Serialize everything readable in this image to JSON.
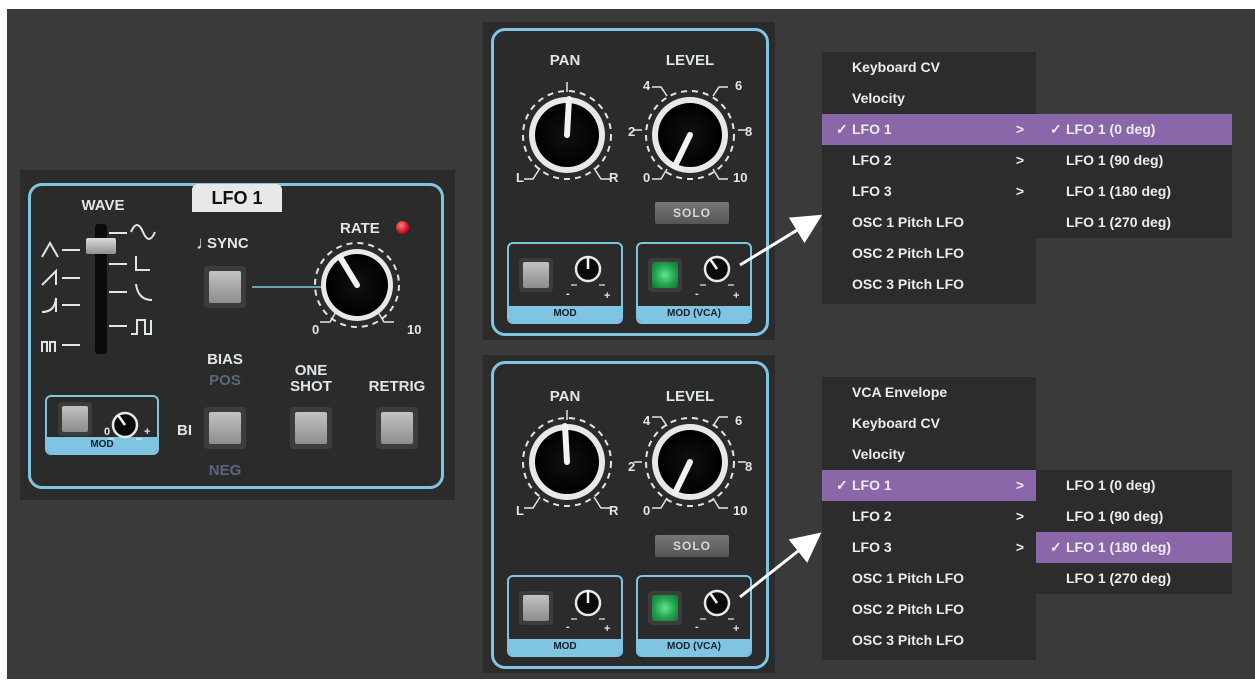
{
  "lfo": {
    "title": "LFO 1",
    "wave_label": "WAVE",
    "sync_label": "SYNC",
    "sync_note_icon": "♩",
    "rate_label": "RATE",
    "rate_min": "0",
    "rate_max": "10",
    "bias_label": "BIAS",
    "bias_pos": "POS",
    "bias_neg": "NEG",
    "bias_bi": "BI",
    "one_shot_line1": "ONE",
    "one_shot_line2": "SHOT",
    "retrig_label": "RETRIG",
    "mod_label": "MOD",
    "mod_zero": "0",
    "mod_plus": "+",
    "accent_color": "#7fc4e0",
    "led_color": "#e0202a"
  },
  "mixers": [
    {
      "pan_label": "PAN",
      "pan_left": "L",
      "pan_right": "R",
      "level_label": "LEVEL",
      "level_ticks": {
        "t0": "0",
        "t2": "2",
        "t4": "4",
        "t6": "6",
        "t8": "8",
        "t10": "10"
      },
      "solo_label": "SOLO",
      "mod_label": "MOD",
      "mod_vca_label": "MOD (VCA)",
      "minus": "-",
      "plus": "+"
    },
    {
      "pan_label": "PAN",
      "pan_left": "L",
      "pan_right": "R",
      "level_label": "LEVEL",
      "level_ticks": {
        "t0": "0",
        "t2": "2",
        "t4": "4",
        "t6": "6",
        "t8": "8",
        "t10": "10"
      },
      "solo_label": "SOLO",
      "mod_label": "MOD",
      "mod_vca_label": "MOD (VCA)",
      "minus": "-",
      "plus": "+"
    }
  ],
  "menus": [
    {
      "items": [
        {
          "label": "Keyboard CV"
        },
        {
          "label": "Velocity"
        },
        {
          "label": "LFO 1",
          "checked": "✓",
          "submenu": ">"
        },
        {
          "label": "LFO 2",
          "submenu": ">"
        },
        {
          "label": "LFO 3",
          "submenu": ">"
        },
        {
          "label": "OSC 1 Pitch LFO"
        },
        {
          "label": "OSC 2 Pitch LFO"
        },
        {
          "label": "OSC 3 Pitch LFO"
        }
      ],
      "submenu_items": [
        {
          "label": "LFO 1 (0 deg)",
          "checked": "✓"
        },
        {
          "label": "LFO 1 (90 deg)"
        },
        {
          "label": "LFO 1 (180 deg)"
        },
        {
          "label": "LFO 1 (270 deg)"
        }
      ]
    },
    {
      "items": [
        {
          "label": "VCA Envelope"
        },
        {
          "label": "Keyboard CV"
        },
        {
          "label": "Velocity"
        },
        {
          "label": "LFO 1",
          "checked": "✓",
          "submenu": ">"
        },
        {
          "label": "LFO 2",
          "submenu": ">"
        },
        {
          "label": "LFO 3",
          "submenu": ">"
        },
        {
          "label": "OSC 1 Pitch LFO"
        },
        {
          "label": "OSC 2 Pitch LFO"
        },
        {
          "label": "OSC 3 Pitch LFO"
        }
      ],
      "submenu_items": [
        {
          "label": "LFO 1 (0 deg)"
        },
        {
          "label": "LFO 1 (90 deg)"
        },
        {
          "label": "LFO 1 (180 deg)",
          "checked": "✓"
        },
        {
          "label": "LFO 1 (270 deg)"
        }
      ]
    }
  ],
  "colors": {
    "menu_highlight": "#8a67a8",
    "panel_bg": "#2b2b2b",
    "page_bg": "#3a3a3a"
  }
}
